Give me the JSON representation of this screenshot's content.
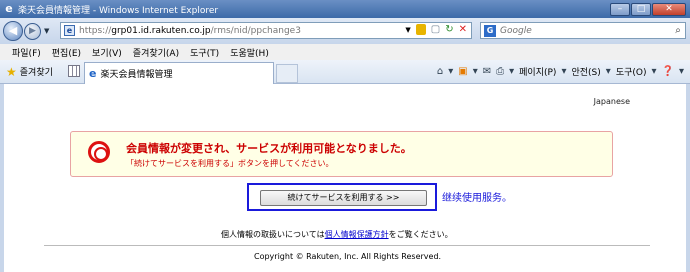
{
  "window": {
    "title": "楽天会員情報管理 - Windows Internet Explorer",
    "min_label": "–",
    "max_label": "□",
    "close_label": "✕"
  },
  "address_bar": {
    "url_prefix": "https://",
    "url_host": "grp01.id.rakuten.co.jp",
    "url_path": "/rms/nid/ppchange3",
    "search_placeholder": "Google"
  },
  "menu": [
    "파일(F)",
    "편집(E)",
    "보기(V)",
    "즐겨찾기(A)",
    "도구(T)",
    "도움말(H)"
  ],
  "favorites_bar": {
    "favorites_label": "즐겨찾기",
    "tab_title": "楽天会員情報管理",
    "commands": [
      "페이지(P)",
      "안전(S)",
      "도구(O)"
    ]
  },
  "page": {
    "language": "Japanese",
    "notice_title": "会員情報が変更され、サービスが利用可能となりました。",
    "notice_sub": "「続けてサービスを利用する」ボタンを押してください。",
    "continue_button": "続けてサービスを利用する >>",
    "annotation": "继续使用服务。",
    "privacy_prefix": "個人情報の取扱いについては",
    "privacy_link": "個人情報保護方針",
    "privacy_suffix": "をご覧ください。",
    "copyright": "Copyright © Rakuten, Inc. All Rights Reserved."
  },
  "colors": {
    "notice_text": "#cc0000",
    "notice_bg": "#ffffe6",
    "highlight_border": "#1a1adb"
  }
}
